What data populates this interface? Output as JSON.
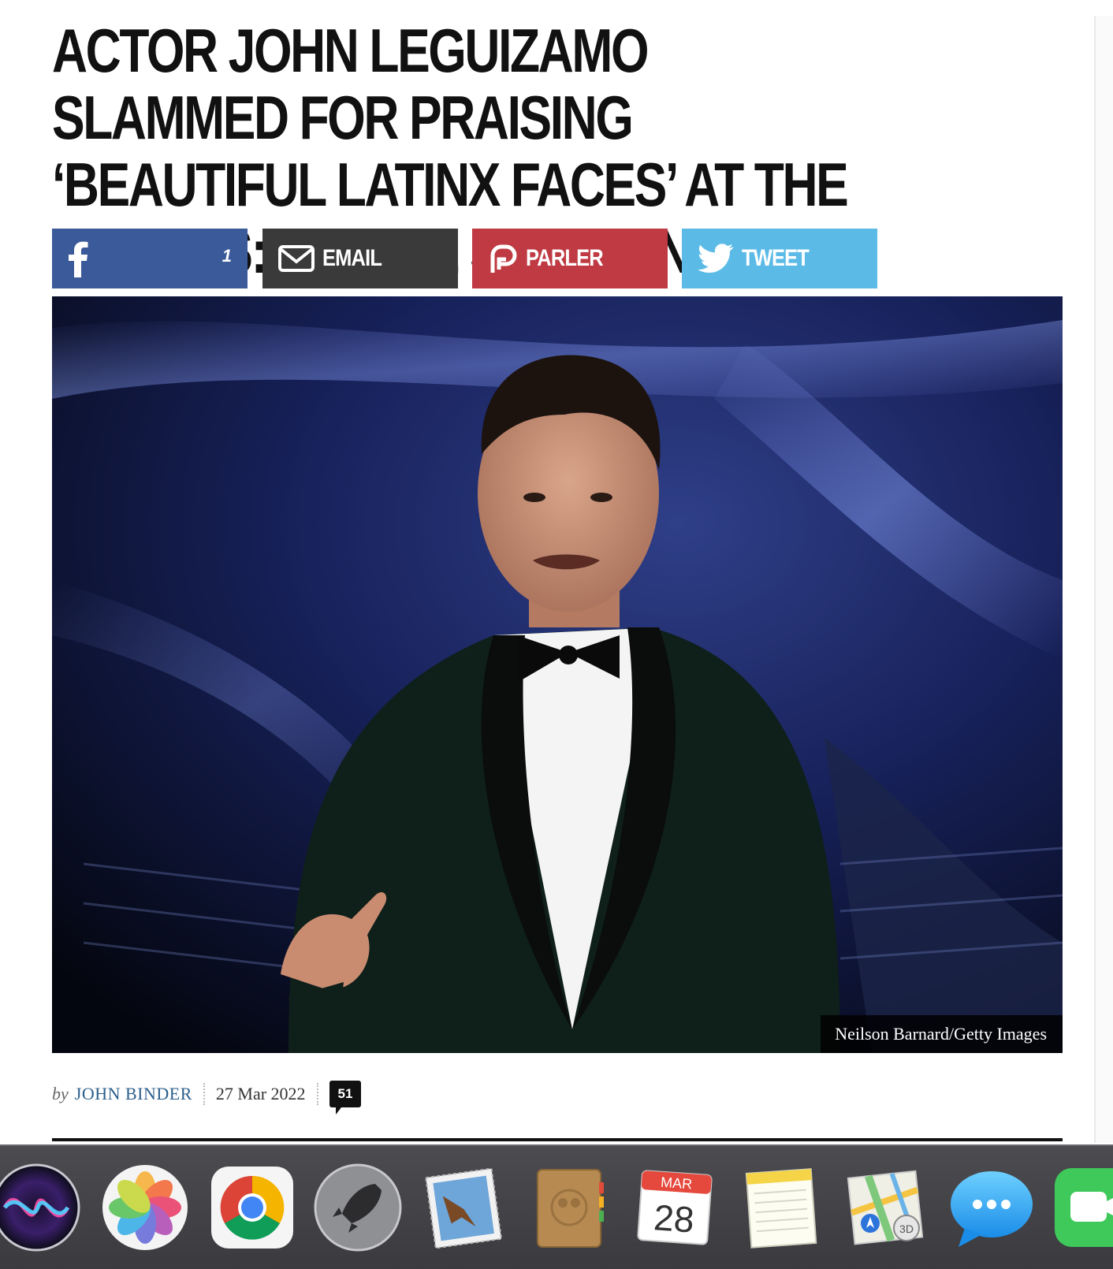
{
  "article": {
    "headline": "ACTOR JOHN LEGUIZAMO SLAMMED FOR PRAISING ‘BEAUTIFUL LATINX FACES’ AT THE OSCARS: ‘VIRTUE SIGNALING’",
    "share": {
      "facebook_count": "1",
      "email_label": "EMAIL",
      "parler_label": "PARLER",
      "tweet_label": "TWEET"
    },
    "photo_credit": "Neilson Barnard/Getty Images",
    "byline": {
      "prefix": "by",
      "author": "JOHN BINDER",
      "date": "27 Mar 2022",
      "comment_count": "51"
    }
  },
  "colors": {
    "facebook": "#3b5a9a",
    "email": "#3a3a3a",
    "parler": "#bf3a42",
    "twitter": "#5bbbe6",
    "author_link": "#2d5f8c"
  },
  "dock": {
    "apps": [
      {
        "name": "Siri",
        "icon": "siri-icon"
      },
      {
        "name": "Photos",
        "icon": "photos-icon"
      },
      {
        "name": "Google Chrome",
        "icon": "chrome-icon"
      },
      {
        "name": "Launchpad",
        "icon": "launchpad-icon"
      },
      {
        "name": "Mail",
        "icon": "mail-icon"
      },
      {
        "name": "Contacts",
        "icon": "contacts-icon"
      },
      {
        "name": "Calendar",
        "icon": "calendar-icon"
      },
      {
        "name": "Notes",
        "icon": "notes-icon"
      },
      {
        "name": "Maps",
        "icon": "maps-icon"
      },
      {
        "name": "Messages",
        "icon": "messages-icon"
      },
      {
        "name": "FaceTime",
        "icon": "facetime-icon"
      }
    ],
    "calendar": {
      "month": "MAR",
      "day": "28"
    },
    "maps_badge": "3D"
  }
}
